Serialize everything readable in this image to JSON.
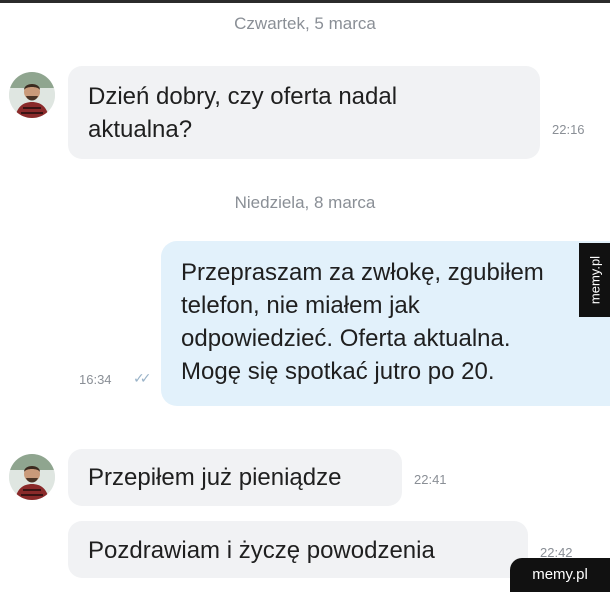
{
  "dates": {
    "first": "Czwartek, 5 marca",
    "second": "Niedziela, 8 marca"
  },
  "messages": [
    {
      "direction": "incoming",
      "lines": [
        "Dzień dobry, czy oferta nadal",
        "aktualna?"
      ],
      "time": "22:16"
    },
    {
      "direction": "outgoing",
      "lines": [
        "Przepraszam za zwłokę, zgubiłem",
        "telefon, nie miałem jak",
        "odpowiedzieć. Oferta aktualna.",
        "Mogę się spotkać jutro po 20."
      ],
      "time": "16:34",
      "status_icon": "double-check-icon"
    },
    {
      "direction": "incoming",
      "lines": [
        "Przepiłem już pieniądze"
      ],
      "time": "22:41"
    },
    {
      "direction": "incoming",
      "lines": [
        "Pozdrawiam i życzę powodzenia"
      ],
      "time": "22:42"
    }
  ],
  "avatar_icon": "user-avatar-icon",
  "watermark": {
    "side": "memy.pl",
    "corner": "memy.pl"
  },
  "colors": {
    "incoming_bubble": "#f1f2f4",
    "outgoing_bubble": "#e2f1fb",
    "meta_text": "#8a8f96",
    "check_marks": "#9ab3c8"
  }
}
